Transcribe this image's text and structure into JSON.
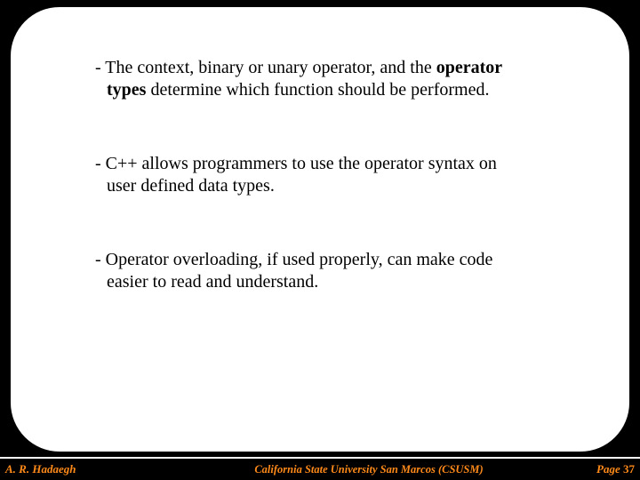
{
  "bullets": {
    "b1a": "- The context, binary or unary operator, and the ",
    "b1b_bold1": "operator",
    "b1c_bold2": "types",
    "b1d": " determine which function should be performed.",
    "b2a": "- C++ allows programmers to use the operator syntax on",
    "b2b": "user defined data types.",
    "b3a": "- Operator overloading, if used properly, can make code",
    "b3b": "easier to read and understand."
  },
  "footer": {
    "author": "A. R. Hadaegh",
    "institution": "California State University San Marcos (CSUSM)",
    "page_word": "Page",
    "page_num": "37"
  }
}
